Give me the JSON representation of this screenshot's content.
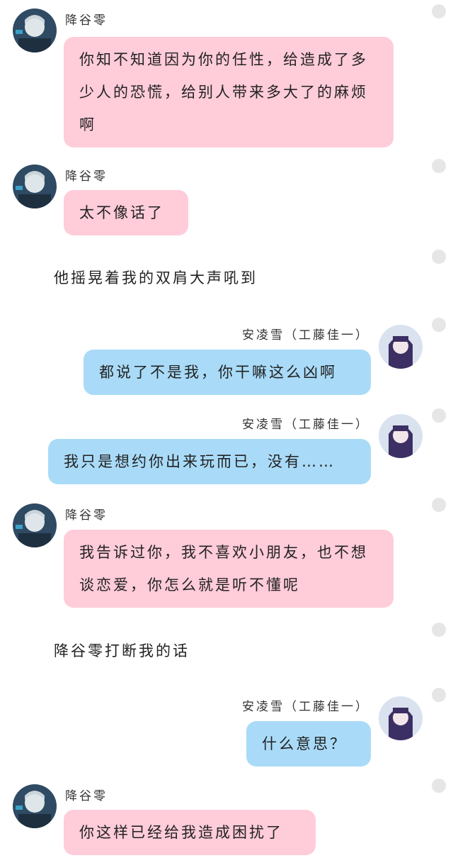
{
  "colors": {
    "left_bubble": "#ffccda",
    "right_bubble": "#a9dbf8",
    "unread_dot": "#e6e6e6"
  },
  "messages": [
    {
      "side": "left",
      "name": "降谷零",
      "text": "你知不知道因为你的任性，给造成了多少人的恐慌，给别人带来多大了的麻烦啊"
    },
    {
      "side": "left",
      "name": "降谷零",
      "text": "太不像话了"
    },
    {
      "side": "narration",
      "text": "他摇晃着我的双肩大声吼到"
    },
    {
      "side": "right",
      "name": "安凌雪（工藤佳一）",
      "text": "都说了不是我，你干嘛这么凶啊"
    },
    {
      "side": "right",
      "name": "安凌雪（工藤佳一）",
      "text": "我只是想约你出来玩而已，没有……"
    },
    {
      "side": "left",
      "name": "降谷零",
      "text": "我告诉过你，我不喜欢小朋友，也不想谈恋爱，你怎么就是听不懂呢"
    },
    {
      "side": "narration",
      "text": "降谷零打断我的话"
    },
    {
      "side": "right",
      "name": "安凌雪（工藤佳一）",
      "text": "什么意思？"
    },
    {
      "side": "left",
      "name": "降谷零",
      "text": "你这样已经给我造成困扰了"
    }
  ]
}
